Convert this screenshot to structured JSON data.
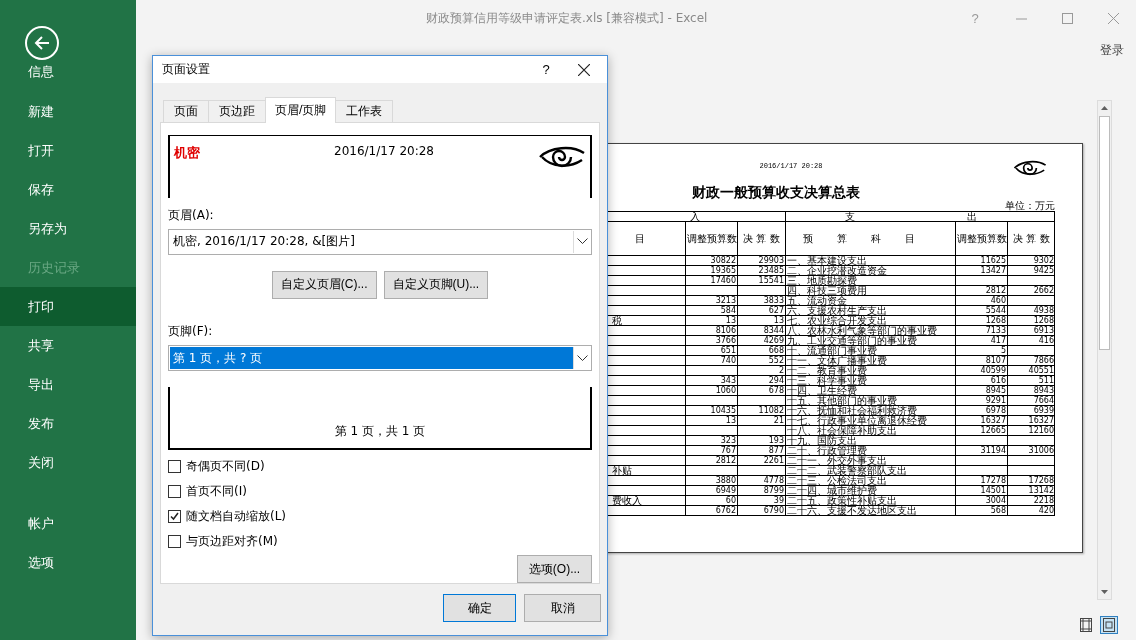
{
  "window": {
    "title": "财政预算信用等级申请评定表.xls  [兼容模式] - Excel",
    "help": "?",
    "sign_in": "登录"
  },
  "backstage": {
    "items": [
      {
        "label": "信息",
        "selected": false,
        "disabled": false
      },
      {
        "label": "新建",
        "selected": false,
        "disabled": false
      },
      {
        "label": "打开",
        "selected": false,
        "disabled": false
      },
      {
        "label": "保存",
        "selected": false,
        "disabled": false
      },
      {
        "label": "另存为",
        "selected": false,
        "disabled": false
      },
      {
        "label": "历史记录",
        "selected": false,
        "disabled": true
      },
      {
        "label": "打印",
        "selected": true,
        "disabled": false
      },
      {
        "label": "共享",
        "selected": false,
        "disabled": false
      },
      {
        "label": "导出",
        "selected": false,
        "disabled": false
      },
      {
        "label": "发布",
        "selected": false,
        "disabled": false
      },
      {
        "label": "关闭",
        "selected": false,
        "disabled": false
      }
    ],
    "footer_items": [
      {
        "label": "帐户",
        "selected": false,
        "disabled": false
      },
      {
        "label": "选项",
        "selected": false,
        "disabled": false
      }
    ]
  },
  "preview": {
    "date": "2016/1/17 20:28",
    "title": "财政一般预算收支决算总表",
    "unit": "单位：万元",
    "group_headings": [
      "入",
      "支",
      "出"
    ],
    "columns": [
      "目",
      "调整预算数",
      "决 算 数",
      "预算科目",
      "调整预算数",
      "决 算 数"
    ],
    "rows": [
      {
        "col_2": "30822",
        "col_3": "29903",
        "col_4": "一、基本建设支出",
        "col_5": "11625",
        "col_6": "9302"
      },
      {
        "col_2": "19365",
        "col_3": "23485",
        "col_4": "二、企业挖潜改造资金",
        "col_5": "13427",
        "col_6": "9425"
      },
      {
        "col_2": "17460",
        "col_3": "15541",
        "col_4": "三、地质勘探费"
      },
      {
        "col_4": "四、科技三项费用",
        "col_5": "2812",
        "col_6": "2662"
      },
      {
        "col_2": "3213",
        "col_3": "3833",
        "col_4": "五、流动资金",
        "col_5": "460"
      },
      {
        "col_2": "584",
        "col_3": "627",
        "col_4": "六、支援农村生产支出",
        "col_5": "5544",
        "col_6": "4938"
      },
      {
        "col_1": "税",
        "col_2": "13",
        "col_3": "13",
        "col_4": "七、农业综合开发支出",
        "col_5": "1268",
        "col_6": "1268"
      },
      {
        "col_2": "8106",
        "col_3": "8344",
        "col_4": "八、农林水利气象等部门的事业费",
        "col_5": "7133",
        "col_6": "6913"
      },
      {
        "col_2": "3766",
        "col_3": "4269",
        "col_4": "九、工业交通等部门的事业费",
        "col_5": "417",
        "col_6": "416"
      },
      {
        "col_2": "651",
        "col_3": "668",
        "col_4": "十、流通部门事业费",
        "col_5": "5"
      },
      {
        "col_2": "740",
        "col_3": "552",
        "col_4": "十一、文体广播事业费",
        "col_5": "8107",
        "col_6": "7866"
      },
      {
        "col_3": "2",
        "col_4": "十二、教育事业费",
        "col_5": "40599",
        "col_6": "40551"
      },
      {
        "col_2": "343",
        "col_3": "294",
        "col_4": "十三、科学事业费",
        "col_5": "616",
        "col_6": "511"
      },
      {
        "col_2": "1060",
        "col_3": "678",
        "col_4": "十四、卫生经费",
        "col_5": "8945",
        "col_6": "8943"
      },
      {
        "col_4": "十五、其他部门的事业费",
        "col_5": "9291",
        "col_6": "7664"
      },
      {
        "col_2": "10435",
        "col_3": "11082",
        "col_4": "十六、抚恤和社会福利救济费",
        "col_5": "6978",
        "col_6": "6939"
      },
      {
        "col_2": "13",
        "col_3": "21",
        "col_4": "十七、行政事业单位离退休经费",
        "col_5": "16327",
        "col_6": "16327"
      },
      {
        "col_4": "十八、社会保障补助支出",
        "col_5": "12665",
        "col_6": "12160"
      },
      {
        "col_2": "323",
        "col_3": "193",
        "col_4": "十九、国防支出"
      },
      {
        "col_2": "767",
        "col_3": "877",
        "col_4": "二十、行政管理费",
        "col_5": "31194",
        "col_6": "31006"
      },
      {
        "col_2": "2812",
        "col_3": "2261",
        "col_4": "二十一、外交外事支出"
      },
      {
        "col_1": "补贴",
        "col_4": "二十二、武装警察部队支出"
      },
      {
        "col_2": "3880",
        "col_3": "4778",
        "col_4": "二十三、公检法司支出",
        "col_5": "17278",
        "col_6": "17268"
      },
      {
        "col_2": "6949",
        "col_3": "8799",
        "col_4": "二十四、城市维护费",
        "col_5": "14501",
        "col_6": "13142"
      },
      {
        "col_1": "费收入",
        "col_2": "60",
        "col_3": "39",
        "col_4": "二十五、政策性补贴支出",
        "col_5": "3004",
        "col_6": "2218"
      },
      {
        "col_2": "6762",
        "col_3": "6790",
        "col_4": "二十六、支援不发达地区支出",
        "col_5": "568",
        "col_6": "420"
      }
    ]
  },
  "dialog": {
    "title": "页面设置",
    "help": "?",
    "tabs": [
      {
        "label": "页面",
        "selected": false
      },
      {
        "label": "页边距",
        "selected": false
      },
      {
        "label": "页眉/页脚",
        "selected": true
      },
      {
        "label": "工作表",
        "selected": false
      }
    ],
    "header_preview": {
      "left": "机密",
      "center": "2016/1/17 20:28"
    },
    "header_label": "页眉(A):",
    "header_field": {
      "value": "机密, 2016/1/17 20:28, &[图片]",
      "selected": false
    },
    "buttons": [
      "自定义页眉(C)...",
      "自定义页脚(U)..."
    ],
    "footer_label": "页脚(F):",
    "footer_field": {
      "value": "第 1 页，共 ? 页",
      "selected": true
    },
    "footer_preview": "第 1 页，共 1 页",
    "options": [
      {
        "label": "奇偶页不同(D)",
        "checked": false
      },
      {
        "label": "首页不同(I)",
        "checked": false
      },
      {
        "label": "随文档自动缩放(L)",
        "checked": true
      },
      {
        "label": "与页边距对齐(M)",
        "checked": false
      }
    ],
    "options_button": "选项(O)...",
    "ok": "确定",
    "cancel": "取消"
  }
}
